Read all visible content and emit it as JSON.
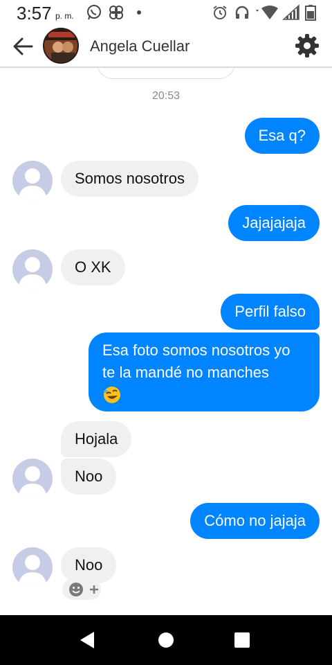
{
  "status_bar": {
    "time": "3:57",
    "ampm": "p. m.",
    "icons": [
      "whatsapp-icon",
      "pinwheel-icon",
      "dot-icon",
      "alarm-icon",
      "headphones-icon",
      "wifi-icon",
      "signal-icon",
      "battery-icon"
    ]
  },
  "header": {
    "contact_name": "Angela Cuellar",
    "icons": [
      "back-arrow-icon",
      "settings-gear-icon"
    ]
  },
  "thread": {
    "timestamp": "20:53",
    "messages": [
      {
        "direction": "out",
        "text": "Esa q?"
      },
      {
        "direction": "in",
        "text": "Somos nosotros"
      },
      {
        "direction": "out",
        "text": "Jajajajaja"
      },
      {
        "direction": "in",
        "text": "O XK"
      },
      {
        "direction": "out",
        "text": "Perfil falso"
      },
      {
        "direction": "out",
        "text": "Esa foto somos nosotros yo te la mandé no manches",
        "emoji": "rolling-laughing-emoji"
      },
      {
        "direction": "in",
        "text": "Hojala"
      },
      {
        "direction": "in",
        "text": "Noo"
      },
      {
        "direction": "out",
        "text": "Cómo no jajaja"
      },
      {
        "direction": "in",
        "text": "Noo"
      }
    ],
    "reaction_icons": [
      "smiley-icon",
      "plus-icon"
    ]
  },
  "nav_bar": {
    "icons": [
      "back-triangle-icon",
      "home-circle-icon",
      "recents-square-icon"
    ]
  },
  "colors": {
    "outgoing_bubble": "#0084ff",
    "incoming_bubble": "#f0f0f0",
    "avatar_placeholder": "#c7cce6"
  }
}
